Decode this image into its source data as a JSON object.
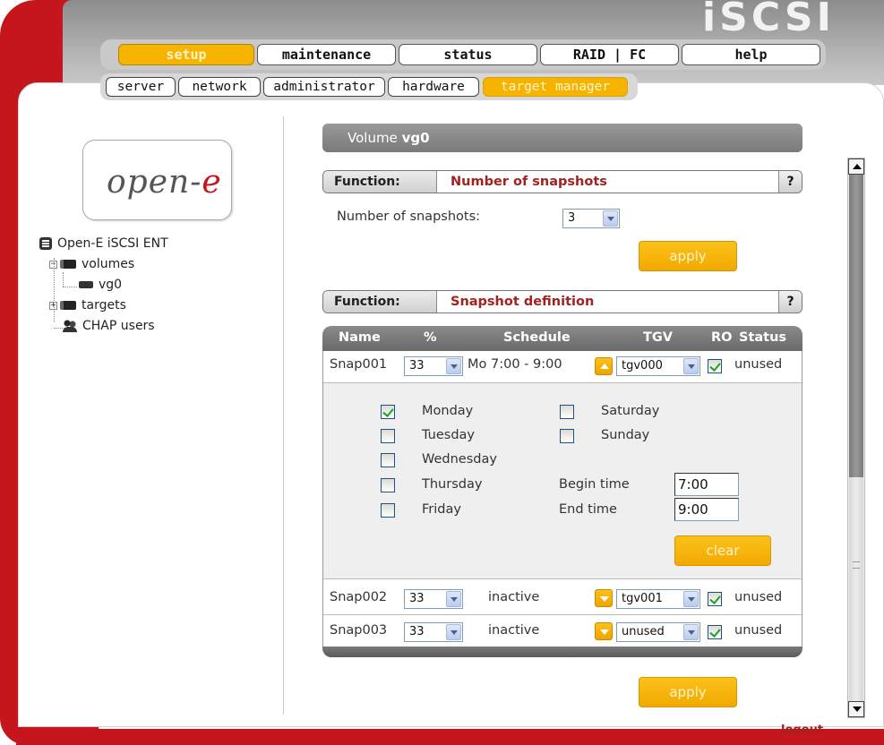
{
  "brand": "iSCSI",
  "main_tabs": [
    {
      "label": "setup",
      "active": true
    },
    {
      "label": "maintenance",
      "active": false
    },
    {
      "label": "status",
      "active": false
    },
    {
      "label": "RAID | FC",
      "active": false
    },
    {
      "label": "help",
      "active": false
    }
  ],
  "sub_tabs": [
    {
      "label": "server",
      "active": false
    },
    {
      "label": "network",
      "active": false
    },
    {
      "label": "administrator",
      "active": false
    },
    {
      "label": "hardware",
      "active": false
    },
    {
      "label": "target manager",
      "active": true
    }
  ],
  "logo": {
    "text_main": "open-",
    "text_accent": "e"
  },
  "tree": {
    "root": "Open-E iSCSI ENT",
    "volumes": "volumes",
    "vg0": "vg0",
    "targets": "targets",
    "chap": "CHAP users"
  },
  "volume_bar": {
    "prefix": "Volume",
    "name": "vg0"
  },
  "function_label": "Function:",
  "help_label": "?",
  "num_snapshots": {
    "title": "Number of snapshots",
    "field_label": "Number of snapshots:",
    "value": "3",
    "apply_label": "apply"
  },
  "snapshot_def": {
    "title": "Snapshot definition",
    "columns": [
      "Name",
      "%",
      "Schedule",
      "TGV",
      "RO",
      "Status"
    ],
    "rows": [
      {
        "name": "Snap001",
        "percent": "33",
        "schedule": "Mo 7:00 - 9:00",
        "tgv": "tgv000",
        "ro": true,
        "status": "unused",
        "expanded": true
      },
      {
        "name": "Snap002",
        "percent": "33",
        "schedule": "inactive",
        "tgv": "tgv001",
        "ro": true,
        "status": "unused",
        "expanded": false
      },
      {
        "name": "Snap003",
        "percent": "33",
        "schedule": "inactive",
        "tgv": "unused",
        "ro": true,
        "status": "unused",
        "expanded": false
      }
    ],
    "days": {
      "monday": {
        "label": "Monday",
        "checked": true
      },
      "tuesday": {
        "label": "Tuesday",
        "checked": false
      },
      "wednesday": {
        "label": "Wednesday",
        "checked": false
      },
      "thursday": {
        "label": "Thursday",
        "checked": false
      },
      "friday": {
        "label": "Friday",
        "checked": false
      },
      "saturday": {
        "label": "Saturday",
        "checked": false
      },
      "sunday": {
        "label": "Sunday",
        "checked": false
      }
    },
    "begin_time_label": "Begin time",
    "begin_time": "7:00",
    "end_time_label": "End time",
    "end_time": "9:00",
    "clear_label": "clear",
    "apply_label": "apply"
  },
  "logout": "logout",
  "colors": {
    "accent": "#f6b400",
    "brand_red": "#c4161c",
    "title_red": "#a3221f"
  }
}
